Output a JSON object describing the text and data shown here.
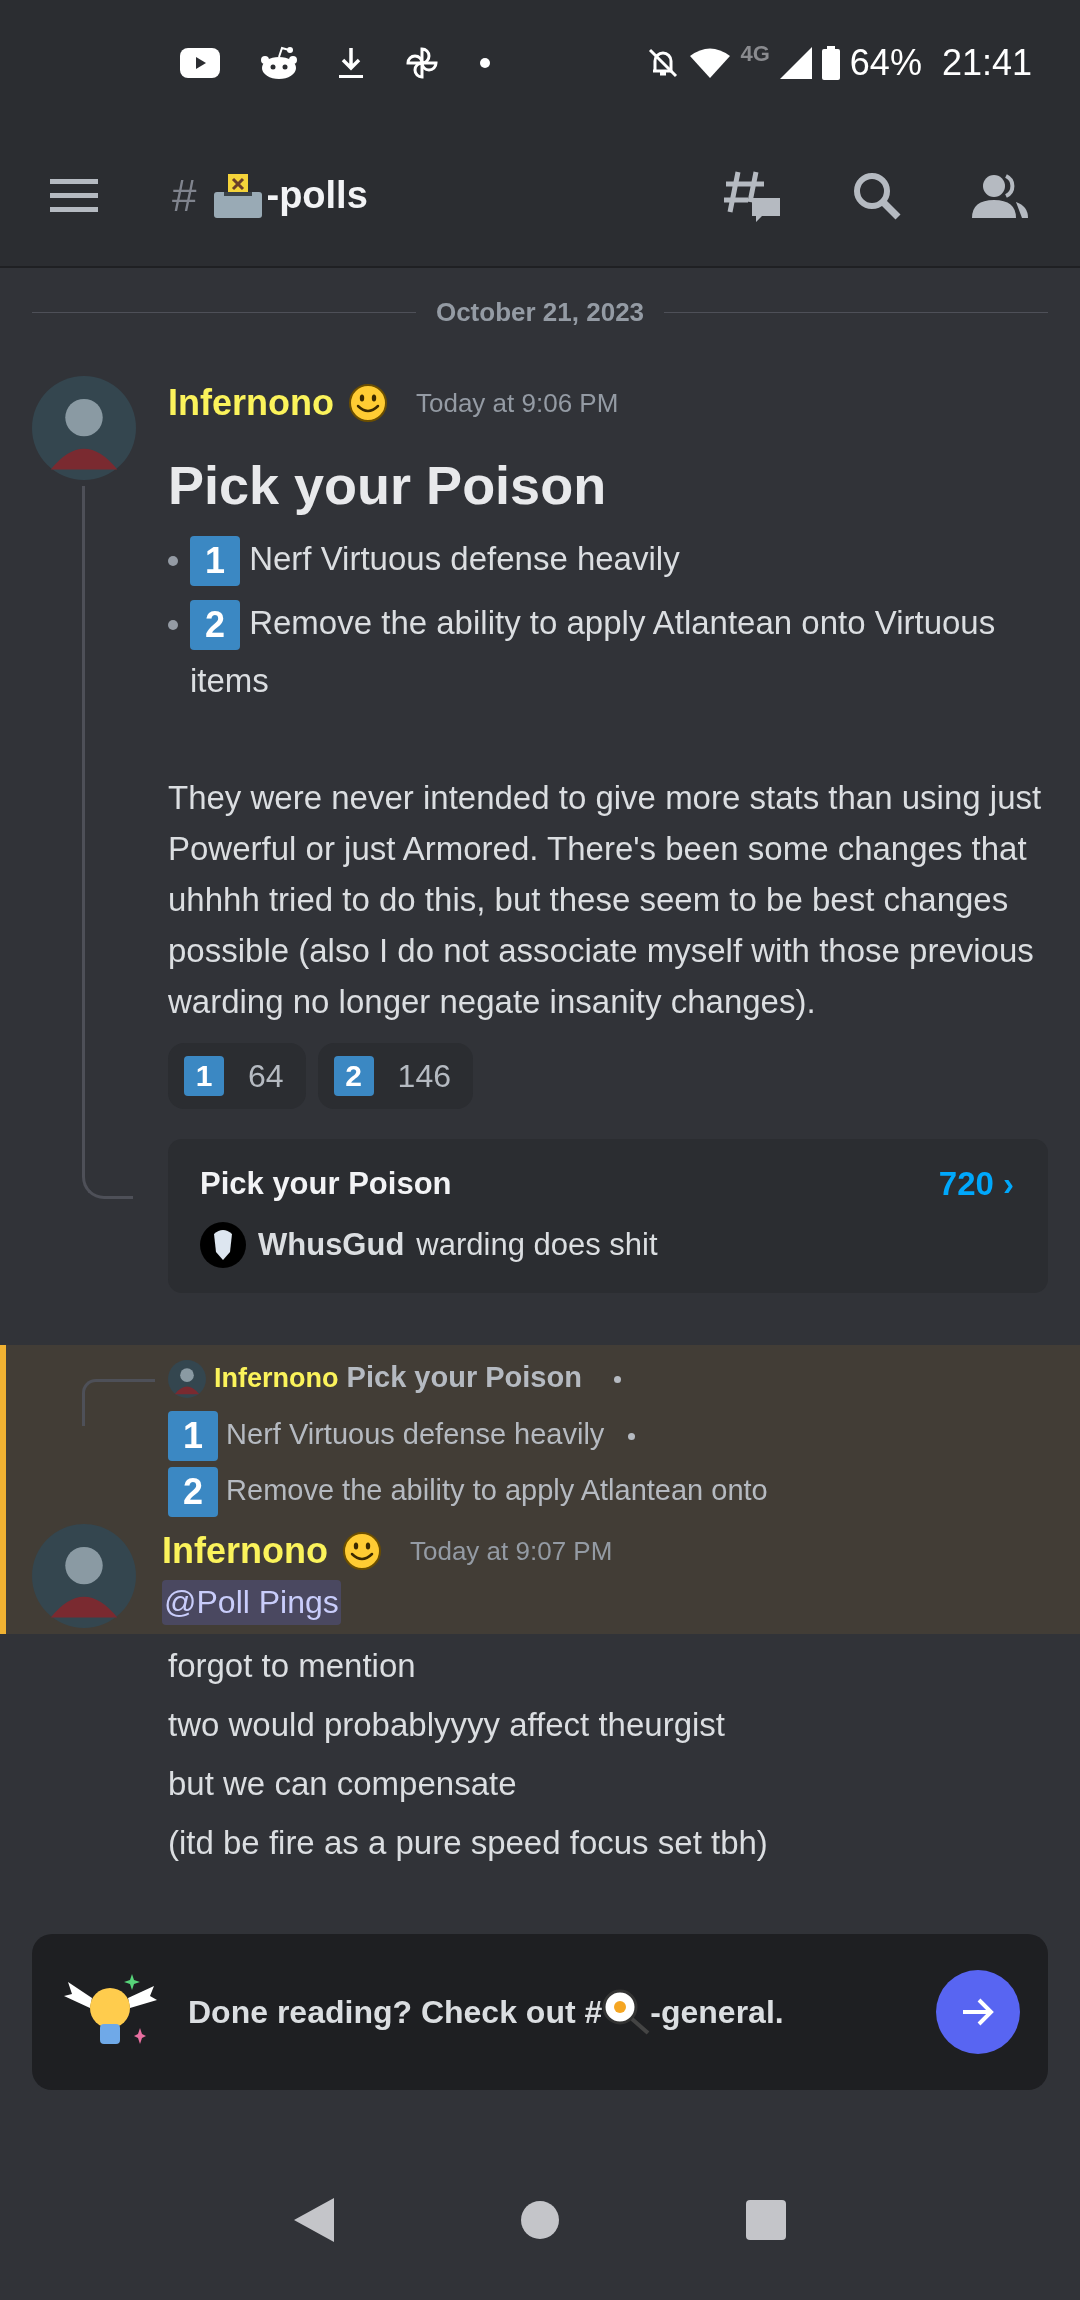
{
  "status_bar": {
    "network": "4G",
    "battery": "64%",
    "time": "21:41"
  },
  "channel": {
    "hash": "#",
    "name": "-polls"
  },
  "date_divider": "October 21, 2023",
  "poll_message": {
    "author": "Infernono",
    "timestamp": "Today at 9:06 PM",
    "title": "Pick your Poison",
    "options": [
      {
        "number": "1",
        "text": "Nerf Virtuous defense heavily"
      },
      {
        "number": "2",
        "text": "Remove the ability to apply Atlantean onto Virtuous items"
      }
    ],
    "body": "They were never intended to give more stats than using just Powerful or just Armored. There's been some changes that uhhhh tried to do this, but these seem to be best changes possible (also I do not associate myself with those previous warding no longer negate insanity changes).",
    "reactions": [
      {
        "number": "1",
        "count": "64"
      },
      {
        "number": "2",
        "count": "146"
      }
    ],
    "thread": {
      "title": "Pick your Poison",
      "count": "720 ›",
      "last_author": "WhusGud",
      "last_text": "warding does shit"
    }
  },
  "reply_message": {
    "highlighted": true,
    "reply_to": {
      "author": "Infernono",
      "title": "Pick your Poison",
      "options": [
        {
          "number": "1",
          "text": "Nerf Virtuous defense heavily"
        },
        {
          "number": "2",
          "text": "Remove the ability to apply Atlantean onto"
        }
      ]
    },
    "author": "Infernono",
    "timestamp": "Today at 9:07 PM",
    "mention": "@Poll Pings",
    "lines": [
      "forgot to mention",
      "two would probablyyyy affect theurgist",
      "but we can compensate",
      "(itd be fire as a pure speed focus set tbh)"
    ]
  },
  "read_prompt": {
    "text_before": "Done reading? Check out #",
    "text_after": "-general."
  }
}
